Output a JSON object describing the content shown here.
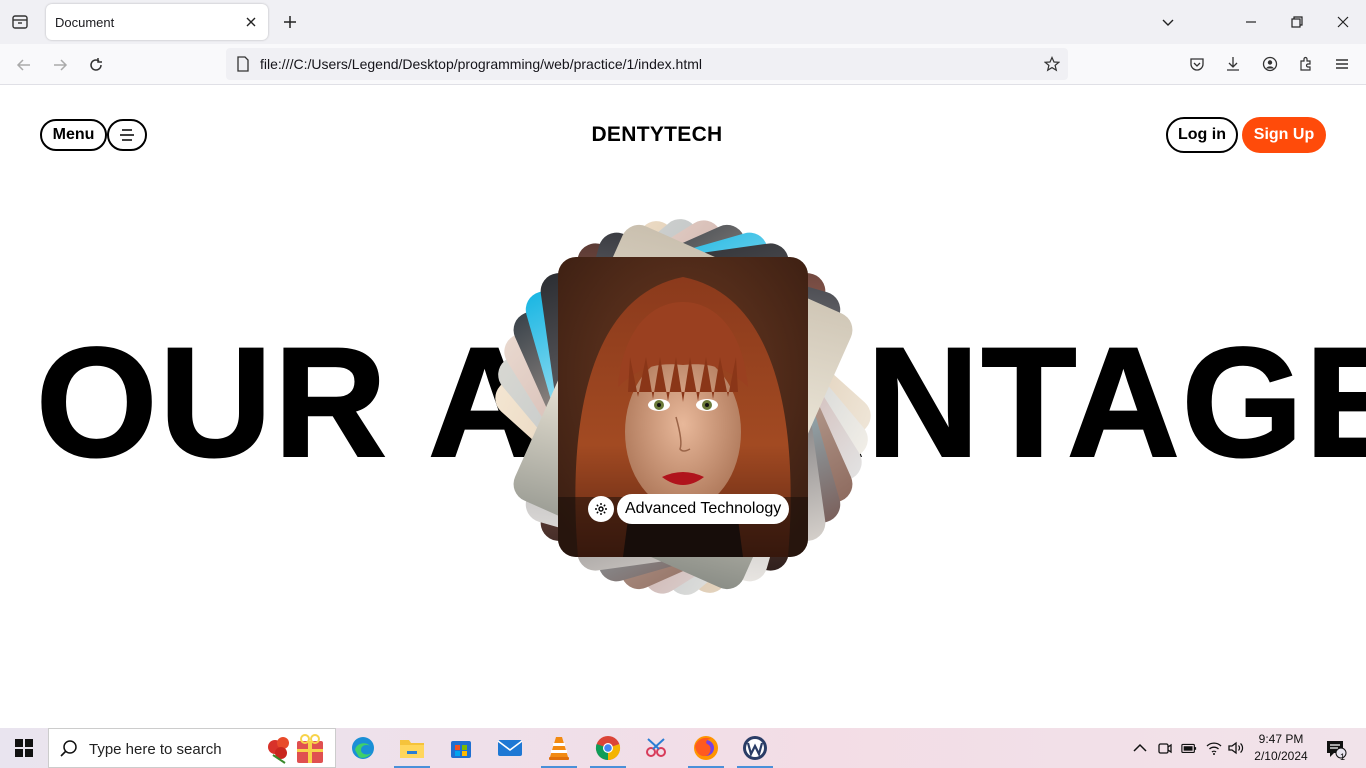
{
  "browser": {
    "tab_title": "Document",
    "url": "file:///C:/Users/Legend/Desktop/programming/web/practice/1/index.html"
  },
  "site": {
    "menu_label": "Menu",
    "brand": "DENTYTECH",
    "login_label": "Log in",
    "signup_label": "Sign Up",
    "headline": "OUR ADVANTAGES",
    "card_caption": "Advanced Technology",
    "accent_color": "#ff4b0a"
  },
  "taskbar": {
    "search_placeholder": "Type here to search",
    "time": "9:47 PM",
    "date": "2/10/2024",
    "notification_count": "1",
    "apps": [
      "edge-icon",
      "file-explorer-icon",
      "store-icon",
      "mail-icon",
      "vlc-icon",
      "chrome-icon",
      "snipping-tool-icon",
      "firefox-icon",
      "wps-icon"
    ]
  }
}
